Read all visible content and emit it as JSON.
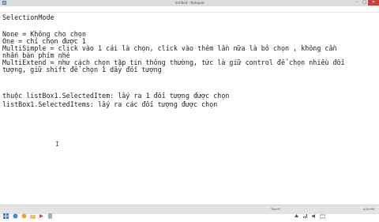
{
  "window": {
    "title": "Untitled - Notepad",
    "buttons": {
      "minimize": "–",
      "maximize": "□",
      "close": "✕"
    }
  },
  "menu": [
    "File",
    "Edit",
    "Format",
    "View",
    "Help"
  ],
  "document": {
    "lines": [
      "SelectionMode",
      "",
      "None = Không cho chọn",
      "One = chỉ chọn được 1",
      "MultiSimple = click vào 1 cái là chọn, click vào thêm lần nữa là bỏ chọn , không cần",
      "nhấn bàn phím nhé",
      "MultiExtend = như cách chọn tập tin thông thường, tức là giữ control để chọn nhiều đối",
      "tượng, giữ shift để chọn 1 dãy đối tượng",
      "",
      "thuộc listBox1.SelectedItem: lấy ra 1 đối tượng được chọn",
      "listBox1.SelectedItems: lấy ra các đối tượng được chọn"
    ],
    "cursor_glyph": "I"
  },
  "taskbar": {
    "icons": [
      "start-icon",
      "explorer-icon",
      "browser-icon",
      "folder-icon",
      "media-icon",
      "notepad-icon"
    ],
    "tray_label": "This PC",
    "clock": "4:20 PM"
  },
  "colors": {
    "titlebar": "#dcdcdc",
    "close_button": "#c7403a",
    "taskbar": "#e4e4e4",
    "text": "#202020"
  }
}
